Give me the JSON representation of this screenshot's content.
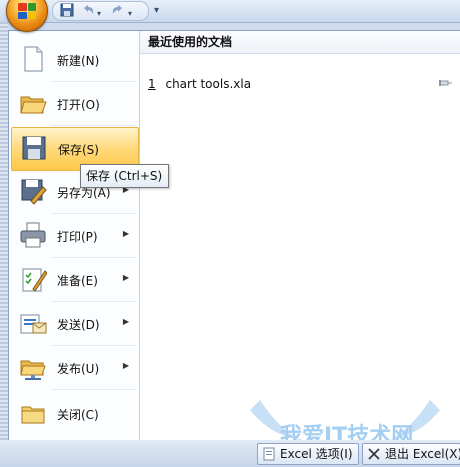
{
  "quick_access": {
    "save_icon": "save-icon",
    "undo_icon": "undo-icon",
    "redo_icon": "redo-icon",
    "customize_glyph": "▾"
  },
  "menu": {
    "items": [
      {
        "name": "new",
        "label": "新建(N)",
        "icon": "new-document-icon",
        "submenu": false
      },
      {
        "name": "open",
        "label": "打开(O)",
        "icon": "open-folder-icon",
        "submenu": false
      },
      {
        "name": "save",
        "label": "保存(S)",
        "icon": "save-disk-icon",
        "submenu": false,
        "active": true
      },
      {
        "name": "save-as",
        "label": "另存为(A)",
        "icon": "save-as-icon",
        "submenu": true
      },
      {
        "name": "print",
        "label": "打印(P)",
        "icon": "printer-icon",
        "submenu": true
      },
      {
        "name": "prepare",
        "label": "准备(E)",
        "icon": "prepare-icon",
        "submenu": true
      },
      {
        "name": "send",
        "label": "发送(D)",
        "icon": "send-icon",
        "submenu": true
      },
      {
        "name": "publish",
        "label": "发布(U)",
        "icon": "publish-icon",
        "submenu": true
      },
      {
        "name": "close",
        "label": "关闭(C)",
        "icon": "close-folder-icon",
        "submenu": false
      }
    ],
    "arrow_glyph": "▶"
  },
  "recent": {
    "heading": "最近使用的文档",
    "files": [
      {
        "num": "1",
        "name": "chart tools.xla"
      }
    ]
  },
  "tooltip": {
    "text": "保存 (Ctrl+S)"
  },
  "bottom": {
    "options_label": "Excel 选项(I)",
    "exit_label": "退出 Excel(X)"
  },
  "watermark": {
    "text": "我爱IT技术网"
  },
  "colors": {
    "active_item": "#ffd97a",
    "orb": "#e98a12"
  }
}
